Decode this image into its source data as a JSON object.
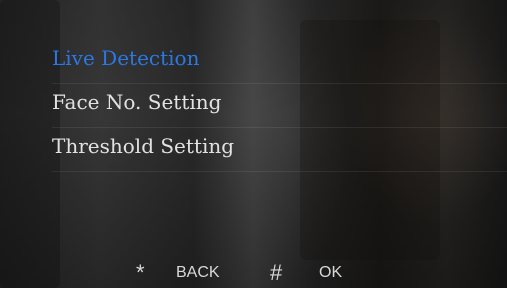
{
  "menu": {
    "items": [
      {
        "label": "Live Detection",
        "selected": true
      },
      {
        "label": "Face No. Setting",
        "selected": false
      },
      {
        "label": "Threshold Setting",
        "selected": false
      }
    ]
  },
  "footer": {
    "back_icon": "*",
    "back_label": "BACK",
    "ok_icon": "#",
    "ok_label": "OK"
  },
  "colors": {
    "selected": "#2b78e4",
    "text": "#e2e2e2"
  }
}
